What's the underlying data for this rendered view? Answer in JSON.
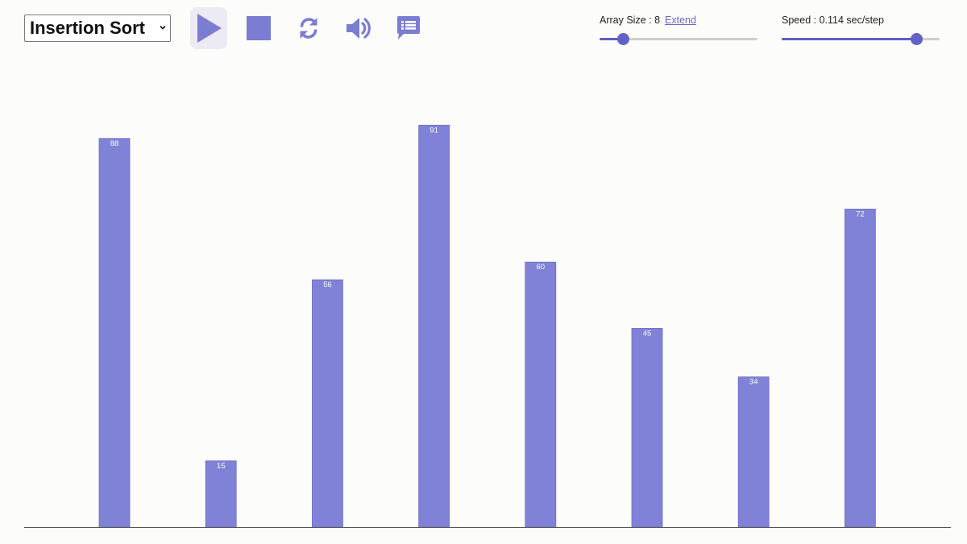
{
  "toolbar": {
    "algorithm_select": {
      "selected": "Insertion Sort"
    },
    "buttons": [
      {
        "name": "play",
        "icon": "play-icon"
      },
      {
        "name": "stop",
        "icon": "stop-icon"
      },
      {
        "name": "reset",
        "icon": "refresh-icon"
      },
      {
        "name": "sound",
        "icon": "speaker-icon"
      },
      {
        "name": "info",
        "icon": "chat-list-icon"
      }
    ],
    "array_size": {
      "label": "Array Size : 8",
      "link": "Extend",
      "level": 0.15
    },
    "speed": {
      "label": "Speed : 0.114 sec/step",
      "level": 0.85
    }
  },
  "colors": {
    "accent": "#7f82d6",
    "icon": "#7a7dd1",
    "slider": "#6262c6"
  },
  "chart_data": {
    "type": "bar",
    "values": [
      88,
      15,
      56,
      91,
      60,
      45,
      34,
      72
    ],
    "ylim": [
      0,
      100
    ],
    "grid": false
  }
}
